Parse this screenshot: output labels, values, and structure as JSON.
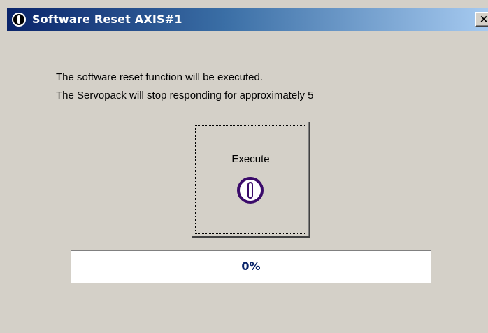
{
  "window": {
    "title": "Software Reset AXIS#1",
    "title_icon": "power-icon",
    "close_label": "×",
    "close_icon": "close-icon"
  },
  "message": {
    "line1": "The software reset function will be executed.",
    "line2": "The Servopack will stop responding for approximately 5"
  },
  "execute_button": {
    "label": "Execute",
    "icon": "power-icon",
    "icon_color": "#3a0a6a"
  },
  "progress": {
    "value_percent": 0,
    "text": "0%",
    "text_color": "#0a246a"
  },
  "colors": {
    "titlebar_start": "#0a246a",
    "titlebar_end": "#a6caf0",
    "dialog_background": "#d4d0c8"
  }
}
